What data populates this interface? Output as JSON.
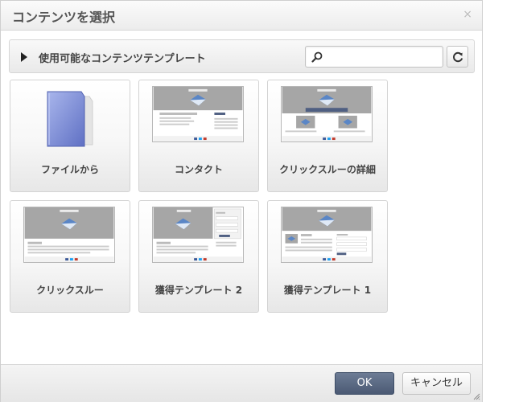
{
  "dialog": {
    "title": "コンテンツを選択",
    "close_icon": "×"
  },
  "toolbar": {
    "expand_icon": "triangle-right-icon",
    "title": "使用可能なコンテンツテンプレート",
    "search": {
      "value": "",
      "placeholder": ""
    },
    "refresh_icon": "refresh-icon"
  },
  "templates": [
    {
      "label": "ファイルから",
      "icon": "folder-icon"
    },
    {
      "label": "コンタクト",
      "icon": "template-thumbnail"
    },
    {
      "label": "クリックスルーの詳細",
      "icon": "template-thumbnail"
    },
    {
      "label": "クリックスルー",
      "icon": "template-thumbnail"
    },
    {
      "label": "獲得テンプレート 2",
      "icon": "template-thumbnail"
    },
    {
      "label": "獲得テンプレート 1",
      "icon": "template-thumbnail"
    }
  ],
  "footer": {
    "ok_label": "OK",
    "cancel_label": "キャンセル"
  },
  "colors": {
    "ok_button": "#56657e",
    "folder": "#7f8fd4",
    "thumb_header": "#a6a6a6",
    "thumb_banner": "#4f5f82"
  }
}
